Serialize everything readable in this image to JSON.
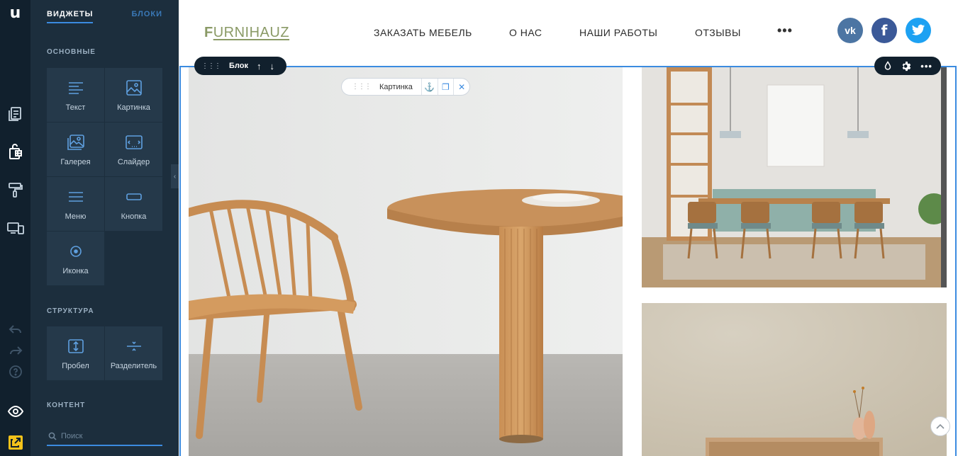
{
  "app": {
    "logo": "u"
  },
  "rail": {
    "icons": [
      "pages-icon",
      "widgets-icon",
      "design-icon",
      "devices-icon",
      "undo-icon",
      "redo-icon",
      "help-icon",
      "preview-icon",
      "publish-icon"
    ]
  },
  "panel": {
    "tabs": {
      "widgets": "ВИДЖЕТЫ",
      "blocks": "БЛОКИ"
    },
    "sections": {
      "basic": {
        "title": "ОСНОВНЫЕ",
        "items": [
          {
            "label": "Текст",
            "icon": "text-icon"
          },
          {
            "label": "Картинка",
            "icon": "image-icon"
          },
          {
            "label": "Галерея",
            "icon": "gallery-icon"
          },
          {
            "label": "Слайдер",
            "icon": "slider-icon"
          },
          {
            "label": "Меню",
            "icon": "menu-icon"
          },
          {
            "label": "Кнопка",
            "icon": "button-icon"
          },
          {
            "label": "Иконка",
            "icon": "icon-widget-icon"
          }
        ]
      },
      "structure": {
        "title": "СТРУКТУРА",
        "items": [
          {
            "label": "Пробел",
            "icon": "spacer-icon"
          },
          {
            "label": "Разделитель",
            "icon": "divider-icon"
          }
        ]
      },
      "content": {
        "title": "КОНТЕНТ"
      }
    },
    "search": {
      "placeholder": "Поиск"
    }
  },
  "site": {
    "brand": {
      "first": "F",
      "rest": "URNIHAUZ"
    },
    "nav": [
      "ЗАКАЗАТЬ МЕБЕЛЬ",
      "О НАС",
      "НАШИ РАБОТЫ",
      "ОТЗЫВЫ"
    ],
    "more": "•••",
    "social": {
      "vk": "vk",
      "fb": "f"
    }
  },
  "editor": {
    "block_label": "Блок",
    "image_toolbar_label": "Картинка"
  },
  "colors": {
    "accent": "#3b8be0",
    "rail": "#11202d",
    "panel": "#1c2e3d",
    "tile": "#25394a",
    "brand": "#8a9a66"
  }
}
